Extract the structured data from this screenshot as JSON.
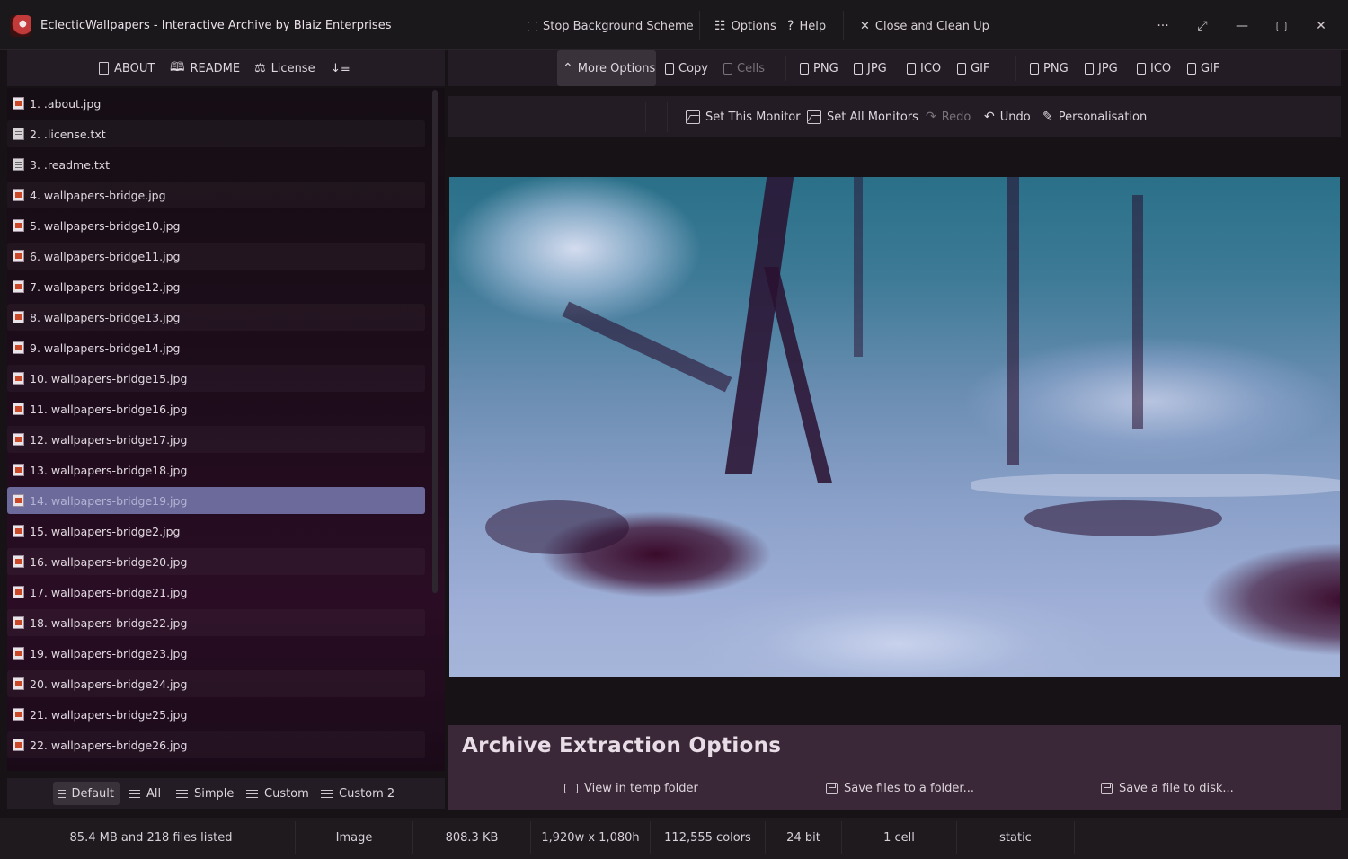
{
  "app": {
    "name": "EclecticWallpapers",
    "separator": " - ",
    "subtitle": "Interactive Archive by Blaiz Enterprises"
  },
  "titlebar": {
    "stop_scheme_label": "Stop Background Scheme",
    "options_label": "Options",
    "help_label": "Help",
    "close_label": "Close and Clean Up",
    "more_label": "···",
    "expand_label": "⤢",
    "minimize_label": "—",
    "maximize_label": "▢",
    "window_close_label": "✕"
  },
  "left_toolbar": {
    "about_label": "ABOUT",
    "readme_label": "README",
    "license_label": "License",
    "sort_label": "↓≡"
  },
  "files": [
    {
      "label": "1. .about.jpg",
      "type": "img"
    },
    {
      "label": "2. .license.txt",
      "type": "txt"
    },
    {
      "label": "3. .readme.txt",
      "type": "txt"
    },
    {
      "label": "4. wallpapers-bridge.jpg",
      "type": "img"
    },
    {
      "label": "5. wallpapers-bridge10.jpg",
      "type": "img"
    },
    {
      "label": "6. wallpapers-bridge11.jpg",
      "type": "img"
    },
    {
      "label": "7. wallpapers-bridge12.jpg",
      "type": "img"
    },
    {
      "label": "8. wallpapers-bridge13.jpg",
      "type": "img"
    },
    {
      "label": "9. wallpapers-bridge14.jpg",
      "type": "img"
    },
    {
      "label": "10. wallpapers-bridge15.jpg",
      "type": "img"
    },
    {
      "label": "11. wallpapers-bridge16.jpg",
      "type": "img"
    },
    {
      "label": "12. wallpapers-bridge17.jpg",
      "type": "img"
    },
    {
      "label": "13. wallpapers-bridge18.jpg",
      "type": "img"
    },
    {
      "label": "14. wallpapers-bridge19.jpg",
      "type": "img",
      "selected": true
    },
    {
      "label": "15. wallpapers-bridge2.jpg",
      "type": "img"
    },
    {
      "label": "16. wallpapers-bridge20.jpg",
      "type": "img"
    },
    {
      "label": "17. wallpapers-bridge21.jpg",
      "type": "img"
    },
    {
      "label": "18. wallpapers-bridge22.jpg",
      "type": "img"
    },
    {
      "label": "19. wallpapers-bridge23.jpg",
      "type": "img"
    },
    {
      "label": "20. wallpapers-bridge24.jpg",
      "type": "img"
    },
    {
      "label": "21. wallpapers-bridge25.jpg",
      "type": "img"
    },
    {
      "label": "22. wallpapers-bridge26.jpg",
      "type": "img"
    }
  ],
  "view_modes": {
    "default_label": "Default",
    "all_label": "All",
    "simple_label": "Simple",
    "custom_label": "Custom",
    "custom2_label": "Custom 2",
    "active": "Default"
  },
  "right_toolbar": {
    "more_options_label": "More Options",
    "copy_label": "Copy",
    "cells_label": "Cells",
    "group1": [
      "PNG",
      "JPG",
      "ICO",
      "GIF"
    ],
    "group2": [
      "PNG",
      "JPG",
      "ICO",
      "GIF"
    ]
  },
  "actions": {
    "set_this_monitor_label": "Set This Monitor",
    "set_all_monitors_label": "Set All Monitors",
    "redo_label": "Redo",
    "undo_label": "Undo",
    "personalisation_label": "Personalisation"
  },
  "extraction": {
    "title": "Archive Extraction Options",
    "view_temp_label": "View in temp folder",
    "save_folder_label": "Save files to a folder...",
    "save_disk_label": "Save a file to disk..."
  },
  "status": {
    "summary": "85.4 MB and 218 files listed",
    "kind": "Image",
    "size": "808.3 KB",
    "dimensions": "1,920w x 1,080h",
    "colors": "112,555 colors",
    "bit_depth": "24 bit",
    "cells": "1 cell",
    "mode": "static"
  }
}
